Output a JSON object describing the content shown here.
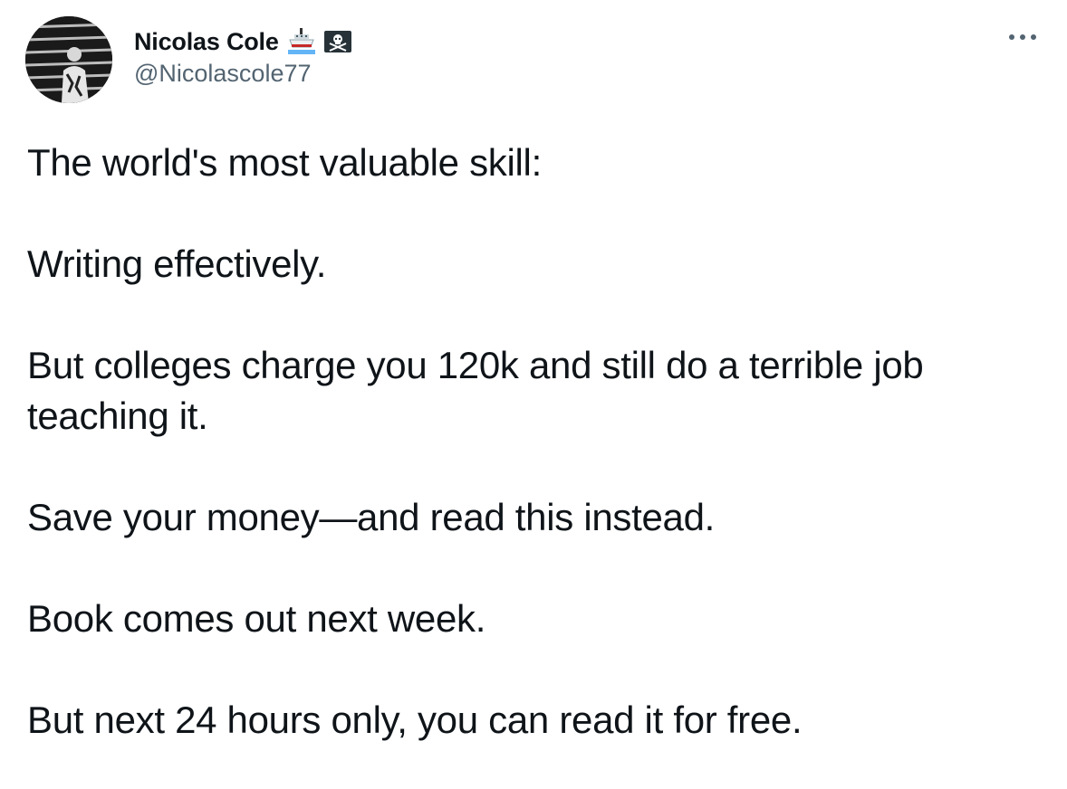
{
  "author": {
    "display_name": "Nicolas Cole",
    "handle": "@Nicolascole77",
    "badges": [
      "ship-emoji-icon",
      "pirate-flag-emoji-icon"
    ]
  },
  "tweet": {
    "paragraphs": [
      "The world's most valuable skill:",
      "Writing effectively.",
      "But colleges charge you 120k and still do a terrible job teaching it.",
      "Save your money—and read this instead.",
      "Book comes out next week.",
      "But next 24 hours only, you can read it for free."
    ]
  },
  "colors": {
    "text": "#0f1419",
    "secondary": "#536471",
    "background": "#ffffff"
  },
  "icons": {
    "more": "more-options-icon"
  }
}
